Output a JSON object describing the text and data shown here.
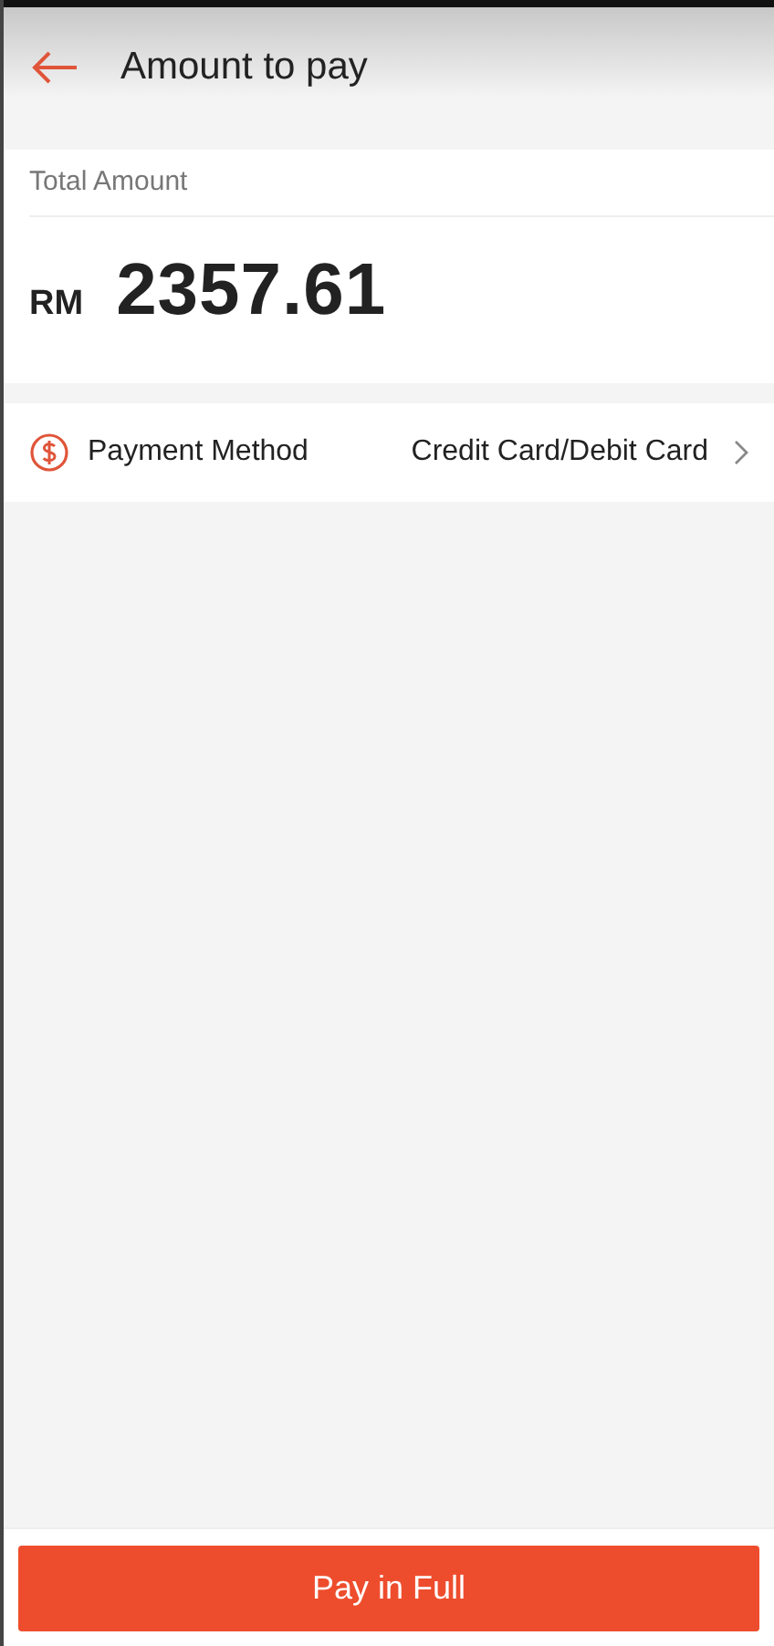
{
  "header": {
    "title": "Amount to pay"
  },
  "total": {
    "label": "Total Amount",
    "currency": "RM",
    "amount": "2357.61"
  },
  "payment_method": {
    "label": "Payment Method",
    "value": "Credit Card/Debit Card"
  },
  "footer": {
    "button": "Pay in Full"
  }
}
